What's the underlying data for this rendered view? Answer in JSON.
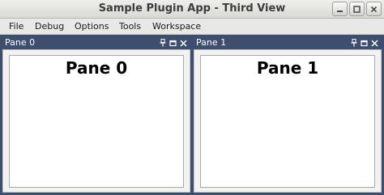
{
  "window": {
    "title": "Sample Plugin App - Third View",
    "controls": [
      "minimize-icon",
      "maximize-icon",
      "close-icon"
    ]
  },
  "menubar": {
    "items": [
      {
        "label": "File"
      },
      {
        "label": "Debug"
      },
      {
        "label": "Options"
      },
      {
        "label": "Tools"
      },
      {
        "label": "Workspace"
      }
    ]
  },
  "panes": [
    {
      "title": "Pane 0",
      "content": "Pane 0",
      "controls": [
        "pin-icon",
        "float-icon",
        "close-icon"
      ]
    },
    {
      "title": "Pane 1",
      "content": "Pane 1",
      "controls": [
        "pin-icon",
        "float-icon",
        "close-icon"
      ]
    }
  ],
  "colors": {
    "dock_background": "#3e4e6e",
    "titlebar": "#e0e0de",
    "menubar": "#e8e8e6",
    "pane_canvas": "#ffffff"
  }
}
